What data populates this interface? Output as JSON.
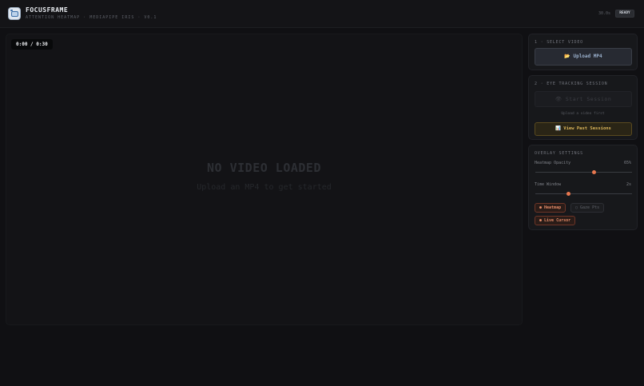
{
  "header": {
    "title": "FOCUSFRAME",
    "subtitle": "ATTENTION HEATMAP · MEDIAPIPE IRIS · V0.1",
    "fps": "30.0s",
    "status": "READY"
  },
  "player": {
    "time": "0:00 / 0:30",
    "empty_title": "NO VIDEO LOADED",
    "empty_hint": "Upload an MP4 to get started"
  },
  "step1": {
    "title": "1 · SELECT VIDEO",
    "upload_label": "📂 Upload MP4"
  },
  "step2": {
    "title": "2 · EYE TRACKING SESSION",
    "start_label": "👁 Start Session",
    "hint": "Upload a video first",
    "past_label": "📊 View Past Sessions"
  },
  "overlay": {
    "title": "OVERLAY SETTINGS",
    "opacity_label": "Heatmap Opacity",
    "opacity_value": "65%",
    "opacity_level": 0.61,
    "window_label": "Time Window",
    "window_value": "2s",
    "window_level": 0.34,
    "toggles": {
      "heatmap": "● Heatmap",
      "gaze": "○ Gaze Pts",
      "cursor": "● Live Cursor"
    }
  },
  "colors": {
    "accent": "#e8774f",
    "gold": "#d9b45a"
  }
}
